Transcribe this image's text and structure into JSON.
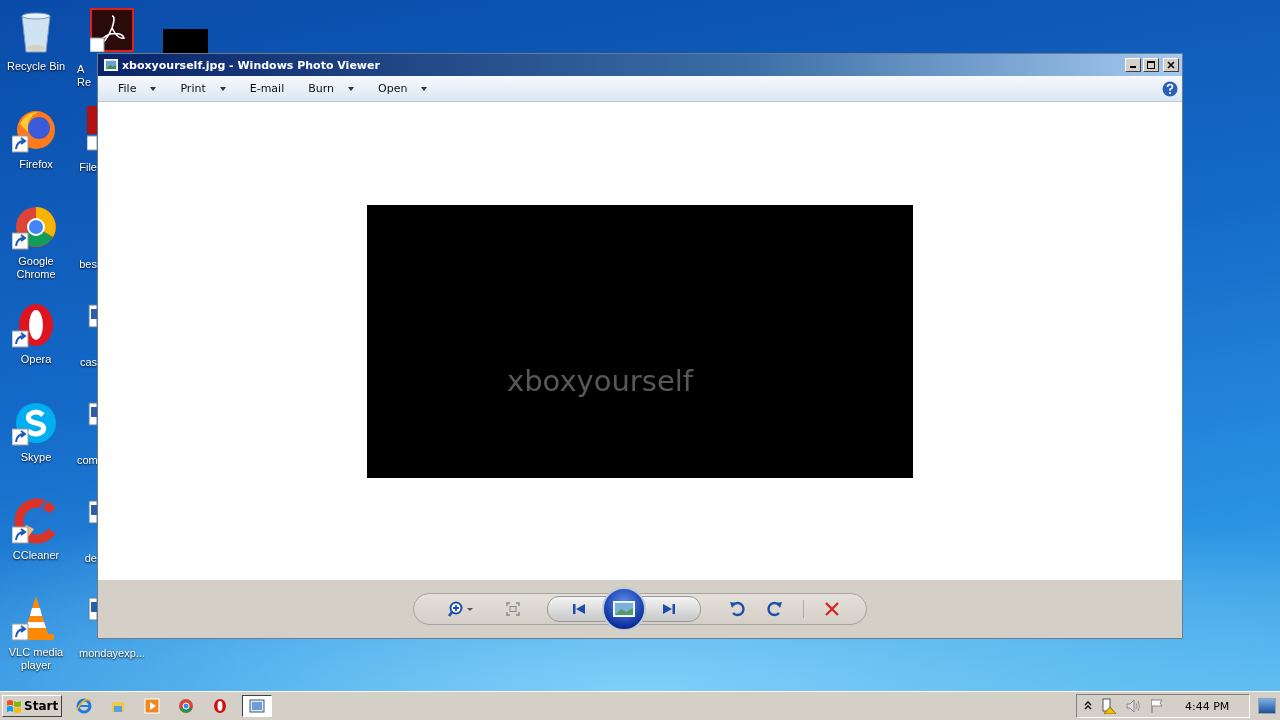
{
  "desktop": {
    "icons": [
      {
        "label": "Recycle Bin",
        "kind": "recycle",
        "shortcut": false
      },
      {
        "label": "Firefox",
        "kind": "firefox",
        "shortcut": true
      },
      {
        "label": "Google Chrome",
        "kind": "chrome",
        "shortcut": true
      },
      {
        "label": "Opera",
        "kind": "opera",
        "shortcut": true
      },
      {
        "label": "Skype",
        "kind": "skype",
        "shortcut": true
      },
      {
        "label": "CCleaner",
        "kind": "ccleaner",
        "shortcut": true
      },
      {
        "label": "VLC media player",
        "kind": "vlc",
        "shortcut": true
      }
    ],
    "partial_icons": [
      {
        "label": "A Re",
        "kind": "adobe"
      },
      {
        "label": "File",
        "kind": "red"
      },
      {
        "label": "bes",
        "kind": "none"
      },
      {
        "label": "cas",
        "kind": "doc"
      },
      {
        "label": "com",
        "kind": "doc"
      },
      {
        "label": "de",
        "kind": "doc"
      },
      {
        "label": "mondayexp...",
        "kind": "doc"
      }
    ],
    "extra_icon": {
      "kind": "black"
    }
  },
  "window": {
    "title": "xboxyourself.jpg - Windows Photo Viewer",
    "menu": [
      {
        "label": "File",
        "dropdown": true
      },
      {
        "label": "Print",
        "dropdown": true
      },
      {
        "label": "E-mail",
        "dropdown": false
      },
      {
        "label": "Burn",
        "dropdown": true
      },
      {
        "label": "Open",
        "dropdown": true
      }
    ],
    "image_text": "xboxyourself"
  },
  "taskbar": {
    "start": "Start",
    "apps": [
      {
        "kind": "ie",
        "selected": false
      },
      {
        "kind": "explorer",
        "selected": false
      },
      {
        "kind": "media",
        "selected": false
      },
      {
        "kind": "chrome",
        "selected": false
      },
      {
        "kind": "opera",
        "selected": false
      },
      {
        "kind": "photo",
        "selected": true
      }
    ],
    "clock": "4:44 PM"
  }
}
